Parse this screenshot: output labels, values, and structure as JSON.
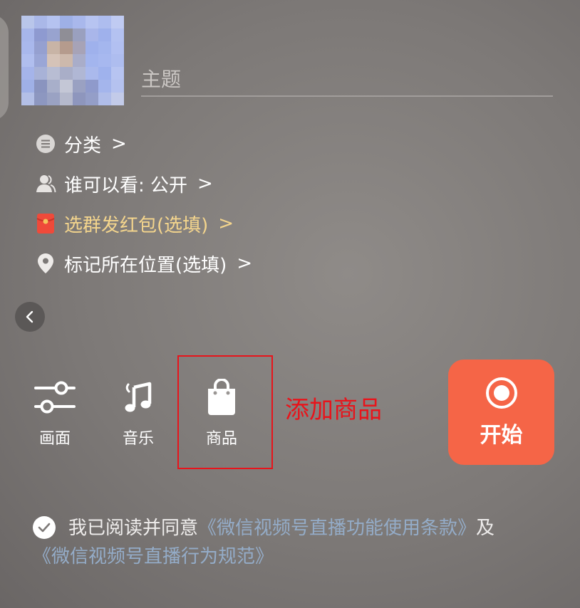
{
  "topic": {
    "placeholder": "主题",
    "value": ""
  },
  "options": {
    "category": {
      "label": "分类",
      "icon": "list-icon",
      "chevron": ">"
    },
    "visibility": {
      "label": "谁可以看: 公开",
      "icon": "person-icon",
      "chevron": ">"
    },
    "red_packet": {
      "label": "选群发红包(选填)",
      "icon": "red-packet-icon",
      "chevron": ">"
    },
    "location": {
      "label": "标记所在位置(选填)",
      "icon": "location-pin-icon",
      "chevron": ">"
    }
  },
  "back_button": {
    "icon": "chevron-left-icon"
  },
  "toolbar": {
    "picture": {
      "label": "画面",
      "icon": "sliders-icon"
    },
    "music": {
      "label": "音乐",
      "icon": "music-note-icon"
    },
    "goods": {
      "label": "商品",
      "icon": "shopping-bag-icon"
    }
  },
  "annotation": {
    "text": "添加商品",
    "color": "#e8141b"
  },
  "start_button": {
    "label": "开始",
    "icon": "record-icon",
    "color": "#f56547"
  },
  "agreement": {
    "prefix": "我已阅读并同意",
    "terms_link": "《微信视频号直播功能使用条款》",
    "conjunction": "及",
    "norms_link": "《微信视频号直播行为规范》",
    "checked": true
  },
  "colors": {
    "gold_text": "#f4d58d",
    "link": "#94acc8",
    "highlight": "#e8141b"
  }
}
